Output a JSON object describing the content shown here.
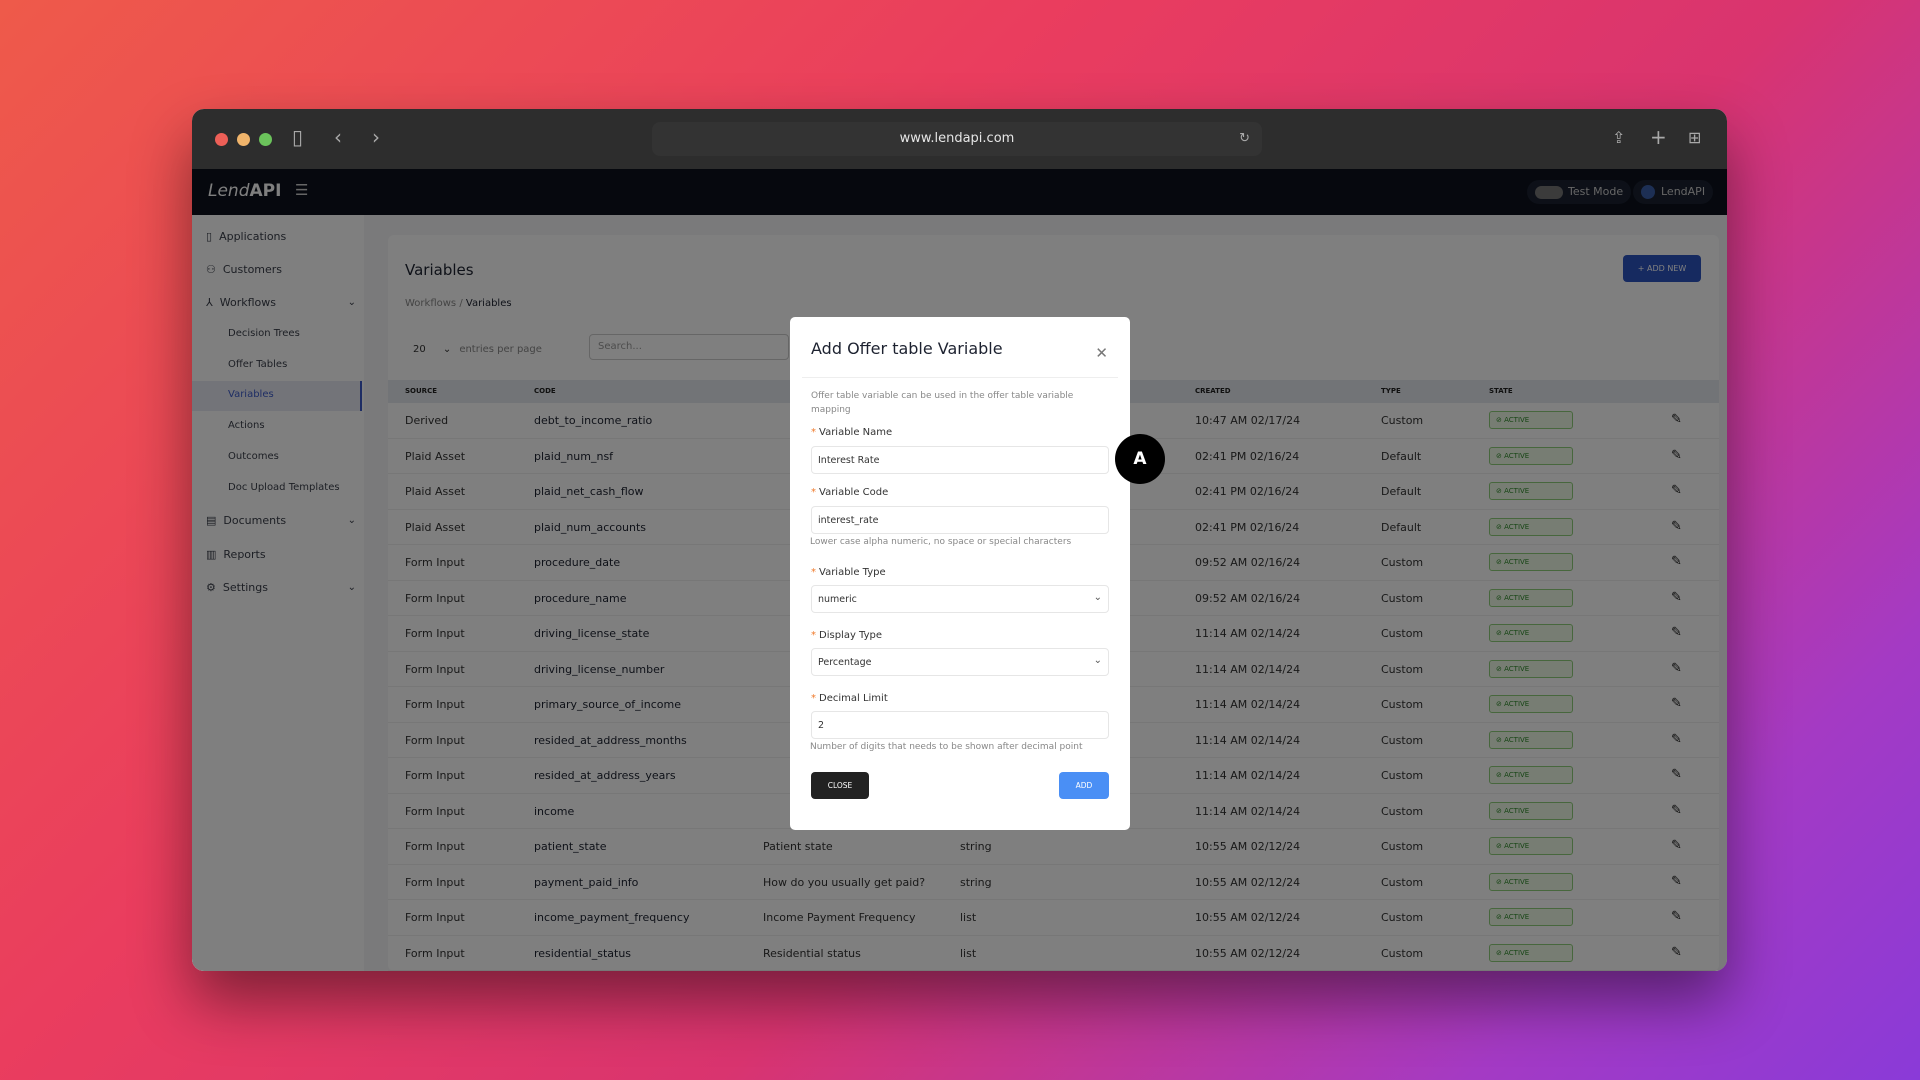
{
  "browser": {
    "url": "www.lendapi.com"
  },
  "app": {
    "logo_light": "Lend",
    "logo_bold": "API",
    "test_mode": "Test Mode",
    "account": "LendAPI"
  },
  "sidebar": {
    "items": [
      {
        "label": "Applications",
        "icon": "file-icon"
      },
      {
        "label": "Customers",
        "icon": "users-icon"
      },
      {
        "label": "Workflows",
        "icon": "workflow-icon"
      },
      {
        "label": "Documents",
        "icon": "document-icon"
      },
      {
        "label": "Reports",
        "icon": "chart-icon"
      },
      {
        "label": "Settings",
        "icon": "gear-icon"
      }
    ],
    "subitems": [
      "Decision Trees",
      "Offer Tables",
      "Variables",
      "Actions",
      "Outcomes",
      "Doc Upload Templates"
    ],
    "active": "Variables"
  },
  "page": {
    "title": "Variables",
    "crumb_parent": "Workflows",
    "crumb_current": "Variables",
    "add_new": "+ ADD NEW",
    "entries": "20",
    "entries_label": "entries per page",
    "search_placeholder": "Search..."
  },
  "table": {
    "headers": {
      "source": "SOURCE",
      "code": "CODE",
      "created": "CREATED",
      "type": "TYPE",
      "state": "STATE"
    },
    "rows": [
      [
        "Derived",
        "debt_to_income_ratio",
        "",
        "",
        "10:47 AM 02/17/24",
        "Custom",
        "ACTIVE"
      ],
      [
        "Plaid Asset",
        "plaid_num_nsf",
        "",
        "",
        "02:41 PM 02/16/24",
        "Default",
        "ACTIVE"
      ],
      [
        "Plaid Asset",
        "plaid_net_cash_flow",
        "",
        "",
        "02:41 PM 02/16/24",
        "Default",
        "ACTIVE"
      ],
      [
        "Plaid Asset",
        "plaid_num_accounts",
        "",
        "",
        "02:41 PM 02/16/24",
        "Default",
        "ACTIVE"
      ],
      [
        "Form Input",
        "procedure_date",
        "",
        "",
        "09:52 AM 02/16/24",
        "Custom",
        "ACTIVE"
      ],
      [
        "Form Input",
        "procedure_name",
        "",
        "",
        "09:52 AM 02/16/24",
        "Custom",
        "ACTIVE"
      ],
      [
        "Form Input",
        "driving_license_state",
        "",
        "",
        "11:14 AM 02/14/24",
        "Custom",
        "ACTIVE"
      ],
      [
        "Form Input",
        "driving_license_number",
        "",
        "",
        "11:14 AM 02/14/24",
        "Custom",
        "ACTIVE"
      ],
      [
        "Form Input",
        "primary_source_of_income",
        "",
        "",
        "11:14 AM 02/14/24",
        "Custom",
        "ACTIVE"
      ],
      [
        "Form Input",
        "resided_at_address_months",
        "",
        "",
        "11:14 AM 02/14/24",
        "Custom",
        "ACTIVE"
      ],
      [
        "Form Input",
        "resided_at_address_years",
        "",
        "",
        "11:14 AM 02/14/24",
        "Custom",
        "ACTIVE"
      ],
      [
        "Form Input",
        "income",
        "",
        "",
        "11:14 AM 02/14/24",
        "Custom",
        "ACTIVE"
      ],
      [
        "Form Input",
        "patient_state",
        "Patient state",
        "string",
        "10:55 AM 02/12/24",
        "Custom",
        "ACTIVE"
      ],
      [
        "Form Input",
        "payment_paid_info",
        "How do you usually get paid?",
        "string",
        "10:55 AM 02/12/24",
        "Custom",
        "ACTIVE"
      ],
      [
        "Form Input",
        "income_payment_frequency",
        "Income Payment Frequency",
        "list",
        "10:55 AM 02/12/24",
        "Custom",
        "ACTIVE"
      ],
      [
        "Form Input",
        "residential_status",
        "Residential status",
        "list",
        "10:55 AM 02/12/24",
        "Custom",
        "ACTIVE"
      ]
    ]
  },
  "modal": {
    "title": "Add Offer table Variable",
    "description": "Offer table variable can be used in the offer table variable mapping",
    "name_label": "Variable Name",
    "name_value": "Interest Rate",
    "code_label": "Variable Code",
    "code_value": "interest_rate",
    "code_hint": "Lower case alpha numeric, no space or special characters",
    "type_label": "Variable Type",
    "type_value": "numeric",
    "display_label": "Display Type",
    "display_value": "Percentage",
    "decimal_label": "Decimal Limit",
    "decimal_value": "2",
    "decimal_hint": "Number of digits that needs to be shown after decimal point",
    "close": "CLOSE",
    "add": "ADD"
  },
  "marker": "A",
  "colors": {
    "primary": "#2c54c1",
    "add": "#4a8ff5",
    "active": "#2e8a2a"
  }
}
